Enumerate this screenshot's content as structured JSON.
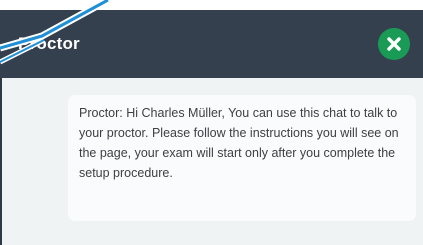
{
  "chat": {
    "title": "Proctor",
    "close_icon": "close-icon",
    "message": {
      "text": "Proctor: Hi Charles Müller, You can use this chat to talk to your proctor. Please follow the instructions you will see on the page, your exam will start only after you complete the setup procedure."
    }
  },
  "colors": {
    "header_bg": "#34404d",
    "close_button_bg": "#1a9b55",
    "body_bg": "#f0f3f4",
    "bubble_bg": "#fafbfc",
    "decor_line": "#1f8fd6"
  }
}
